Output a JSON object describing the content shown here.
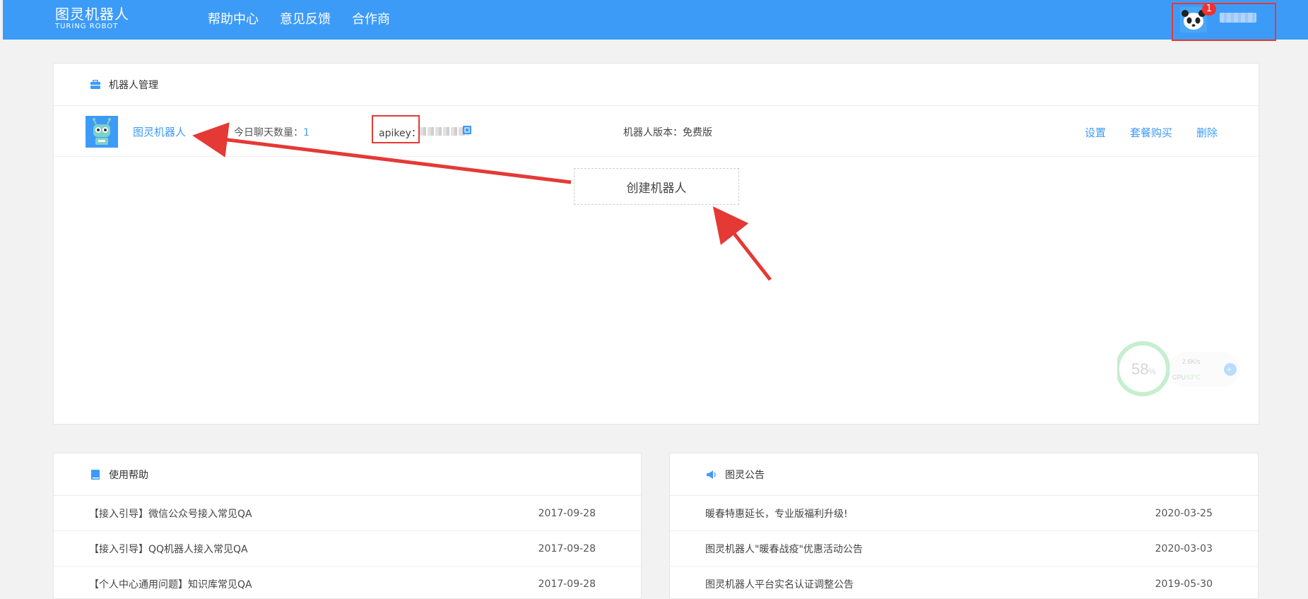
{
  "header": {
    "logo_cn": "图灵机器人",
    "logo_en": "TURING ROBOT",
    "nav": [
      "帮助中心",
      "意见反馈",
      "合作商"
    ],
    "notification_count": "1"
  },
  "robot_panel": {
    "title": "机器人管理",
    "robot": {
      "name": "图灵机器人",
      "chat_label": "今日聊天数量：",
      "chat_count": "1",
      "apikey_label": "apikey：",
      "version_label": "机器人版本：免费版",
      "actions": [
        "设置",
        "套餐购买",
        "删除"
      ]
    },
    "create_label": "创建机器人"
  },
  "help_panel": {
    "title": "使用帮助",
    "items": [
      {
        "title": "【接入引导】微信公众号接入常见QA",
        "date": "2017-09-28"
      },
      {
        "title": "【接入引导】QQ机器人接入常见QA",
        "date": "2017-09-28"
      },
      {
        "title": "【个人中心通用问题】知识库常见QA",
        "date": "2017-09-28"
      }
    ]
  },
  "notice_panel": {
    "title": "图灵公告",
    "items": [
      {
        "title": "暖春特惠延长，专业版福利升级!",
        "date": "2020-03-25"
      },
      {
        "title": "图灵机器人\"暖春战疫\"优惠活动公告",
        "date": "2020-03-03"
      },
      {
        "title": "图灵机器人平台实名认证调整公告",
        "date": "2019-05-30"
      }
    ]
  },
  "system_widget": {
    "percent": "58",
    "percent_unit": "%",
    "speed": "2.6K/s",
    "cpu_label": "CPU",
    "cpu_temp": "53°C"
  },
  "colors": {
    "header_blue": "#3d9bf8",
    "link_blue": "#3d9bf8",
    "highlight_red": "#e53935"
  }
}
